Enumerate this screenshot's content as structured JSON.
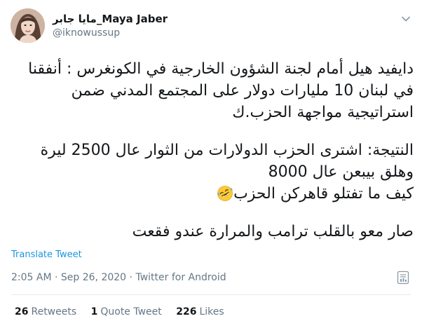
{
  "user": {
    "display_name": "مايا جابر_Maya Jaber",
    "handle": "@iknowussup"
  },
  "tweet": {
    "lines": [
      "دايفيد هيل أمام لجنة الشؤون الخارجية في الكونغرس : أنفقنا",
      "في لبنان  10 مليارات دولار على المجتمع المدني ضمن",
      "استراتيجية مواجهة الحزب.ك",
      "النتيجة: اشترى الحزب الدولارات من الثوار عال 2500 ليرة",
      "وهلق بيبعن عال 8000",
      "كيف ما تفتلو قاهركن الحزب",
      "صار معو بالقلب ترامب والمرارة عندو فقعت"
    ]
  },
  "translate_label": "Translate Tweet",
  "meta": {
    "time": "2:05 AM",
    "separator": "·",
    "date": "Sep 26, 2020",
    "source": "Twitter for Android"
  },
  "stats": {
    "retweets_count": "26",
    "retweets_label": "Retweets",
    "quote_count": "1",
    "quote_label": "Quote Tweet",
    "likes_count": "226",
    "likes_label": "Likes"
  },
  "icons": {
    "caret": "chevron-down-icon",
    "emoji": "rolling-on-floor-laughing-icon",
    "analytics": "analytics-icon"
  },
  "colors": {
    "link": "#1b95e0",
    "muted": "#657786",
    "text": "#14171a",
    "divider": "#e6ecf0"
  }
}
